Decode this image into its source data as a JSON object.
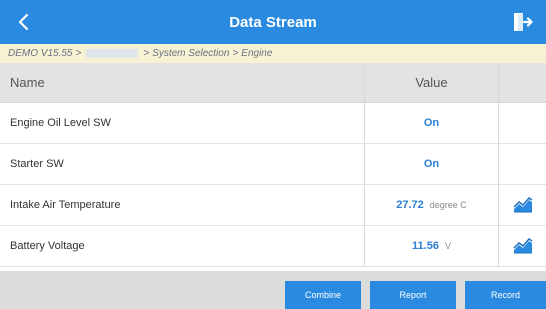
{
  "header": {
    "title": "Data Stream",
    "back_icon": "chevron-left-icon",
    "exit_icon": "exit-icon"
  },
  "breadcrumb": {
    "part1": "DEMO V15.55",
    "sep": ">",
    "part3": "System Selection",
    "part4": "Engine"
  },
  "table": {
    "columns": {
      "name": "Name",
      "value": "Value"
    },
    "rows": [
      {
        "name": "Engine Oil Level SW",
        "value": "On",
        "unit": "",
        "graph": false
      },
      {
        "name": "Starter SW",
        "value": "On",
        "unit": "",
        "graph": false
      },
      {
        "name": "Intake Air Temperature",
        "value": "27.72",
        "unit": "degree C",
        "graph": true
      },
      {
        "name": "Battery Voltage",
        "value": "11.56",
        "unit": "V",
        "graph": true
      }
    ]
  },
  "footer": {
    "combine": "Combine",
    "report": "Report",
    "record": "Record"
  },
  "colors": {
    "accent": "#2a8ae0",
    "value_text": "#2a7fd6",
    "breadcrumb_bg": "#f7f2d4",
    "header_row_bg": "#e3e3e3",
    "footer_bg": "#dcdcdc"
  }
}
